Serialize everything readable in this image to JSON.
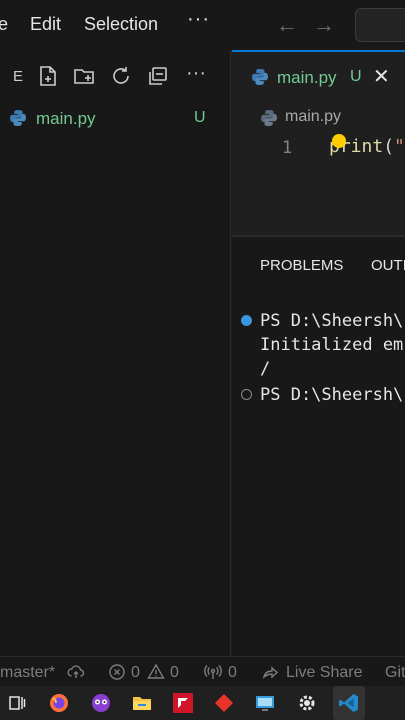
{
  "menu": {
    "items": [
      "e",
      "Edit",
      "Selection"
    ],
    "more": "···"
  },
  "nav": {
    "back": "←",
    "forward": "→"
  },
  "explorer": {
    "header_letter": "E",
    "toolbar_icons": [
      "new-file-icon",
      "new-folder-icon",
      "refresh-icon",
      "collapse-all-icon",
      "more-actions-icon"
    ],
    "more": "···",
    "files": [
      {
        "name": "main.py",
        "status": "U"
      }
    ]
  },
  "editor": {
    "tab": {
      "label": "main.py",
      "badge": "U",
      "close": "✕"
    },
    "breadcrumb": "main.py",
    "lines": [
      {
        "number": "1",
        "code_func": "print",
        "code_paren": "(",
        "code_str": "\""
      }
    ]
  },
  "panel": {
    "tabs": [
      "PROBLEMS",
      "OUTI"
    ],
    "terminal": [
      {
        "marker": "filled",
        "text": "PS D:\\Sheersh\\"
      },
      {
        "marker": "none",
        "text": "Initialized em"
      },
      {
        "marker": "none",
        "text": "/"
      },
      {
        "marker": "empty",
        "text": "PS D:\\Sheersh\\"
      }
    ]
  },
  "statusbar": {
    "branch": "master*",
    "errors": "0",
    "warnings": "0",
    "ports": "0",
    "live_share": "Live Share",
    "git": "Git"
  },
  "taskbar": {
    "apps": [
      "task-view-icon",
      "firefox-icon",
      "app-icon",
      "file-explorer-icon",
      "amd-icon",
      "diamond-app-icon",
      "remote-desktop-icon",
      "settings-gear-icon",
      "vscode-icon"
    ]
  },
  "colors": {
    "accent": "#0078d4",
    "untracked": "#73c991",
    "bg": "#1f1f1f",
    "sidebar_bg": "#181818"
  }
}
